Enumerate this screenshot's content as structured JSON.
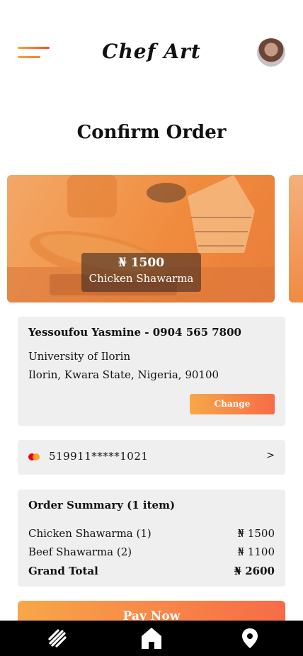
{
  "header": {
    "logo_text": "Chef Art",
    "menu_icon": "menu-icon",
    "avatar": "user-avatar"
  },
  "page": {
    "title": "Confirm Order"
  },
  "featured_item": {
    "price": "₦ 1500",
    "name": "Chicken Shawarma"
  },
  "address": {
    "contact": "Yessoufou Yasmine - 0904 565 7800",
    "line1": "University of Ilorin",
    "line2": "Ilorin, Kwara State, Nigeria, 90100",
    "change_label": "Change"
  },
  "payment": {
    "card_brand_icon": "mastercard-icon",
    "card_number": "519911*****1021",
    "chevron": ">"
  },
  "summary": {
    "title": "Order Summary  (1 item)",
    "items": [
      {
        "label": "Chicken Shawarma (1)",
        "amount": "₦ 1500"
      },
      {
        "label": "Beef Shawarma (2)",
        "amount": "₦ 1100"
      }
    ],
    "grand_total_label": "Grand Total",
    "grand_total_amount": "₦ 2600"
  },
  "pay_button": {
    "label": "Pay Now"
  },
  "bottom_nav": {
    "items": [
      "food-icon",
      "home-icon",
      "location-pin-icon"
    ]
  },
  "colors": {
    "accent_start": "#f7a748",
    "accent_end": "#f76b47",
    "panel_bg": "#efefef",
    "nav_bg": "#000000"
  }
}
